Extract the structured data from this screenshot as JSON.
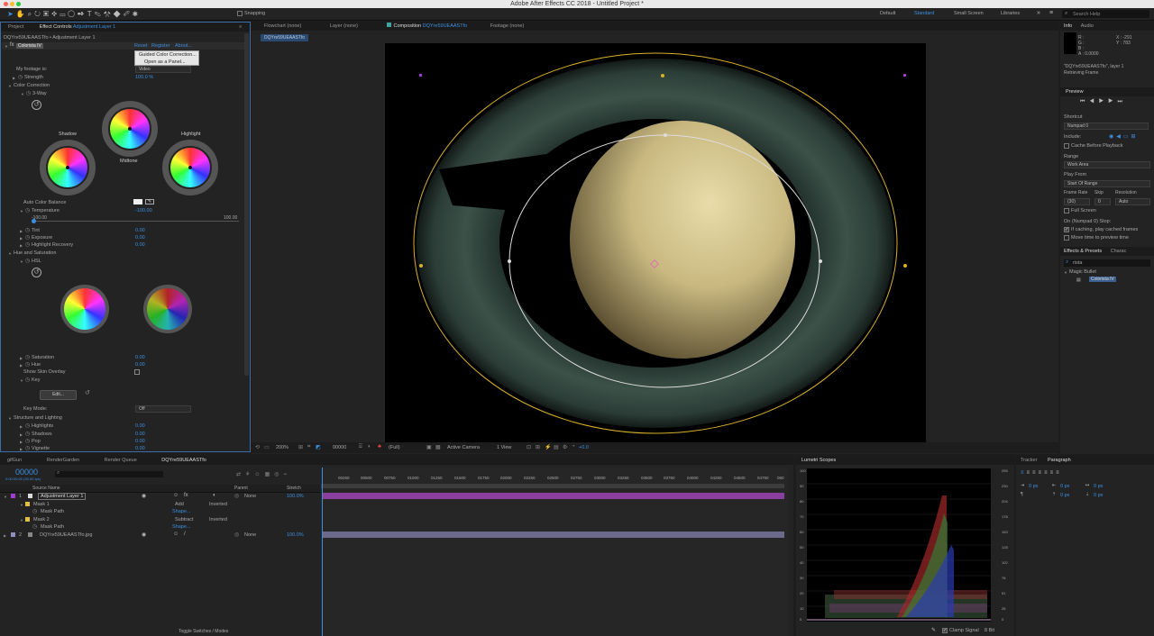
{
  "app": {
    "title": "Adobe After Effects CC 2018 - Untitled Project *"
  },
  "toolbar": {
    "snapping": "Snapping",
    "workspaces": [
      "Default",
      "Standard",
      "Small Screen",
      "Libraries"
    ],
    "active_workspace": "Standard",
    "search_placeholder": "Search Help"
  },
  "left_panel": {
    "tabs": [
      "Project",
      "Effect Controls Adjustment Layer 1"
    ],
    "effect_controls_prefix": "Effect Controls ",
    "effect_controls_layer": "Adjustment Layer 1",
    "breadcrumb": "DQYre59UEAASTfo • Adjustment Layer 1",
    "effect_name": "Colorista IV",
    "effect_links": [
      "Reset",
      "Register",
      "About..."
    ],
    "menu_items": [
      "Guided Color Correction...",
      "Open as a Panel..."
    ],
    "footage_label": "My footage is:",
    "footage_value": "Video",
    "strength_label": "Strength",
    "strength_value": "100.0 %",
    "color_correction": "Color Correction",
    "three_way": "3-Way",
    "wheel_labels": {
      "shadow": "Shadow",
      "midtone": "Midtone",
      "highlight": "Highlight"
    },
    "auto_color_balance": "Auto Color Balance",
    "temperature_label": "Temperature",
    "temperature_value": "-100.00",
    "slider_min": "-100.00",
    "slider_max": "100.00",
    "temperature_level": 0.0,
    "params1": [
      {
        "label": "Tint",
        "value": "0.00"
      },
      {
        "label": "Exposure",
        "value": "0.00"
      },
      {
        "label": "Highlight Recovery",
        "value": "0.00"
      }
    ],
    "hue_saturation": "Hue and Saturation",
    "hsl": "HSL",
    "params2": [
      {
        "label": "Saturation",
        "value": "0.00"
      },
      {
        "label": "Hue",
        "value": "0.00"
      }
    ],
    "skin_overlay": "Show Skin Overlay",
    "key": "Key",
    "edit_button": "Edit...",
    "key_mode_label": "Key Mode:",
    "key_mode_value": "Off",
    "structure": "Structure and Lighting",
    "params3": [
      {
        "label": "Highlights",
        "value": "0.00"
      },
      {
        "label": "Shadows",
        "value": "0.00"
      },
      {
        "label": "Pop",
        "value": "0.00"
      },
      {
        "label": "Vignette",
        "value": "0.00"
      }
    ]
  },
  "viewer": {
    "tabs": [
      "Flowchart (none)",
      "Layer (none)",
      "Composition DQYre59UEAASTfo",
      "Footage (none)"
    ],
    "composition_prefix": "Composition ",
    "composition_name": "DQYre59UEAASTfo",
    "comp_tab_chip": "DQYre59UEAASTfo",
    "zoom": "200%",
    "timecode": "00000",
    "resolution": "(Full)",
    "camera": "Active Camera",
    "views": "1 View",
    "exposure": "+0.0"
  },
  "right_panel": {
    "info_tabs": [
      "Info",
      "Audio"
    ],
    "info": {
      "r": "R :",
      "g": "G :",
      "b": "B :",
      "a": "A : 0.0000",
      "x": "X : -291",
      "y": "Y : 783",
      "line1": "\"DQYre59UEAASTfo\", layer 1",
      "line2": "Retrieving Frame"
    },
    "preview_title": "Preview",
    "shortcut_label": "Shortcut",
    "shortcut_value": "Numpad 0",
    "include_label": "Include:",
    "cache_before": "Cache Before Playback",
    "range_label": "Range",
    "range_value": "Work Area",
    "play_from_label": "Play From",
    "play_from_value": "Start Of Range",
    "frame_rate_label": "Frame Rate",
    "skip_label": "Skip",
    "resolution_label": "Resolution",
    "frame_rate_value": "(30)",
    "skip_value": "0",
    "resolution_value": "Auto",
    "full_screen": "Full Screen",
    "on_stop": "On (Numpad 0) Stop:",
    "if_caching": "If caching, play cached frames",
    "move_time": "Move time to preview time",
    "effects_tabs": [
      "Effects & Presets",
      "Charac"
    ],
    "effects_search": "rista",
    "magic_bullet": "Magic Bullet",
    "colorista": "Colorista IV"
  },
  "timeline": {
    "tabs": [
      "gifGun",
      "RenderGarden",
      "Render Queue",
      "DQYre59UEAASTfo"
    ],
    "timecode": "00000",
    "timecode_sub": "0:00:00:00 (30.00 fps)",
    "headers": {
      "source": "Source Name",
      "parent": "Parent",
      "stretch": "Stretch"
    },
    "ruler": [
      "00250",
      "00500",
      "00750",
      "01000",
      "01250",
      "01500",
      "01750",
      "02000",
      "02250",
      "02500",
      "02750",
      "03000",
      "03250",
      "03500",
      "03750",
      "04000",
      "04250",
      "04500",
      "04750",
      "050"
    ],
    "layers": [
      {
        "num": "1",
        "name": "Adjustment Layer 1",
        "parent": "None",
        "stretch": "100.0%"
      },
      {
        "num": "2",
        "name": "DQYre59UEAASTfo.jpg",
        "parent": "None",
        "stretch": "100.0%"
      }
    ],
    "mask1": {
      "name": "Mask 1",
      "mode": "Add",
      "inverted": "Inverted",
      "path": "Mask Path",
      "shape": "Shape..."
    },
    "mask2": {
      "name": "Mask 2",
      "mode": "Subtract",
      "inverted": "Inverted",
      "path": "Mask Path",
      "shape": "Shape..."
    },
    "toggle": "Toggle Switches / Modes"
  },
  "scopes": {
    "title": "Lumetri Scopes",
    "left_ticks": [
      "100",
      "90",
      "80",
      "70",
      "60",
      "50",
      "40",
      "30",
      "20",
      "10",
      "0"
    ],
    "right_ticks": [
      "255",
      "230",
      "204",
      "178",
      "153",
      "128",
      "102",
      "76",
      "51",
      "26",
      "0"
    ],
    "clamp": "Clamp Signal",
    "bit": "8 Bit"
  },
  "paragraph": {
    "tabs": [
      "Tracker",
      "Paragraph"
    ],
    "fields": [
      "0 px",
      "0 px",
      "0 px",
      "0 px",
      "0 px"
    ]
  }
}
